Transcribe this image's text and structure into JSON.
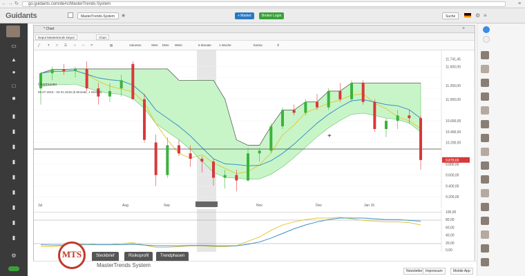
{
  "browser": {
    "url": "go.guidants.com/de#c/MasterTrends-System"
  },
  "header": {
    "logo": "Guidants",
    "workspace": "MasterTrends-System",
    "btn_market": "+ Market",
    "btn_login": "Broker Login",
    "search": "Suche"
  },
  "window": {
    "title": "* Chart",
    "tab1": "Depot Mastertrends Depot",
    "tab2": "Chart"
  },
  "toolbar": {
    "volumen": "Volumen",
    "sma": "SMA",
    "ema": "EMA",
    "wma": "WMA",
    "range": "6 Monate",
    "interval": "1 Woche",
    "extras": "Extras"
  },
  "legend": {
    "line1": "Chartmuster",
    "line2": "06.07.2015 - 04.01.2016 (6 Monate, 1 Woche)"
  },
  "price_axis": [
    "11.741,45",
    "11.600,00",
    "11.250,00",
    "11.000,00",
    "10.600,00",
    "10.400,00",
    "10.200,00",
    "9.878,65",
    "9.800,00",
    "9.600,00",
    "9.400,00",
    "9.200,00"
  ],
  "osc_axis": [
    "100,00",
    "80,00",
    "60,00",
    "40,00",
    "20,00",
    "0,00"
  ],
  "date_labels": [
    "Jul",
    "Aug",
    "Sep",
    "05.10.2015",
    "Nov",
    "Dez",
    "Jan 16"
  ],
  "chart_data": {
    "type": "candlestick",
    "ylim": [
      9150,
      11800
    ],
    "candles": [
      {
        "o": 11200,
        "h": 11500,
        "l": 10900,
        "c": 11480
      },
      {
        "o": 11480,
        "h": 11600,
        "l": 11350,
        "c": 11550
      },
      {
        "o": 11550,
        "h": 11650,
        "l": 11450,
        "c": 11520
      },
      {
        "o": 11520,
        "h": 11600,
        "l": 11400,
        "c": 11560
      },
      {
        "o": 11560,
        "h": 11700,
        "l": 11150,
        "c": 11200
      },
      {
        "o": 11200,
        "h": 11300,
        "l": 10900,
        "c": 11050
      },
      {
        "o": 11050,
        "h": 11300,
        "l": 10950,
        "c": 11150
      },
      {
        "o": 11200,
        "h": 11450,
        "l": 11050,
        "c": 11350
      },
      {
        "o": 11650,
        "h": 11700,
        "l": 11000,
        "c": 11000
      },
      {
        "o": 11000,
        "h": 11100,
        "l": 10200,
        "c": 10250
      },
      {
        "o": 10200,
        "h": 10350,
        "l": 9400,
        "c": 9600
      },
      {
        "o": 9600,
        "h": 10300,
        "l": 9550,
        "c": 10150
      },
      {
        "o": 10150,
        "h": 10250,
        "l": 9950,
        "c": 10000
      },
      {
        "o": 10000,
        "h": 10150,
        "l": 9750,
        "c": 9900
      },
      {
        "o": 9900,
        "h": 9950,
        "l": 9650,
        "c": 9850
      },
      {
        "o": 9850,
        "h": 9900,
        "l": 9400,
        "c": 9550
      },
      {
        "o": 9550,
        "h": 9700,
        "l": 9350,
        "c": 9600
      },
      {
        "o": 9600,
        "h": 9700,
        "l": 9300,
        "c": 9500
      },
      {
        "o": 9500,
        "h": 10100,
        "l": 9480,
        "c": 10000
      },
      {
        "o": 10000,
        "h": 10100,
        "l": 9850,
        "c": 10050
      },
      {
        "o": 10050,
        "h": 10550,
        "l": 10000,
        "c": 10500
      },
      {
        "o": 10500,
        "h": 10850,
        "l": 10450,
        "c": 10800
      },
      {
        "o": 10800,
        "h": 10900,
        "l": 10700,
        "c": 10750
      },
      {
        "o": 10750,
        "h": 11000,
        "l": 10700,
        "c": 10950
      },
      {
        "o": 10950,
        "h": 11100,
        "l": 10800,
        "c": 10850
      },
      {
        "o": 10850,
        "h": 11200,
        "l": 10800,
        "c": 11150
      },
      {
        "o": 11150,
        "h": 11300,
        "l": 10950,
        "c": 11000
      },
      {
        "o": 11000,
        "h": 11350,
        "l": 10950,
        "c": 11300
      },
      {
        "o": 11300,
        "h": 11350,
        "l": 10900,
        "c": 10950
      },
      {
        "o": 10950,
        "h": 11000,
        "l": 10400,
        "c": 10450
      },
      {
        "o": 10450,
        "h": 10650,
        "l": 10300,
        "c": 10600
      },
      {
        "o": 10600,
        "h": 10800,
        "l": 10450,
        "c": 10700
      },
      {
        "o": 10700,
        "h": 10800,
        "l": 10550,
        "c": 10650
      },
      {
        "o": 10650,
        "h": 10700,
        "l": 9700,
        "c": 9878
      }
    ],
    "last_price": "9.878,65"
  }
}
